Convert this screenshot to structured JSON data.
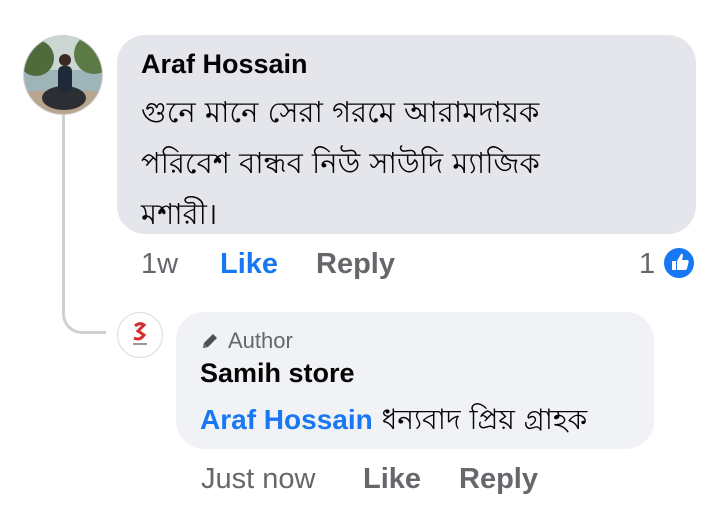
{
  "comment": {
    "author": "Araf Hossain",
    "text_lines": [
      "গুনে মানে সেরা গরমে আরামদায়ক",
      "পরিবেশ বান্ধব  নিউ সাউদি ম্যাজিক",
      "মশারী।"
    ],
    "time": "1w",
    "like_label": "Like",
    "reply_label": "Reply",
    "reaction_count": "1",
    "reaction_icon": "thumbs-up-icon"
  },
  "reply": {
    "badge_label": "Author",
    "badge_icon": "pencil-icon",
    "author": "Samih store",
    "mention": "Araf Hossain",
    "text": " ধন্যবাদ প্রিয় গ্রাহক",
    "time": "Just now",
    "like_label": "Like",
    "reply_label": "Reply"
  },
  "colors": {
    "accent": "#1877f2",
    "comment_bubble": "#e4e6eb",
    "reply_bubble": "#f0f2f5",
    "muted_text": "#65676b"
  }
}
